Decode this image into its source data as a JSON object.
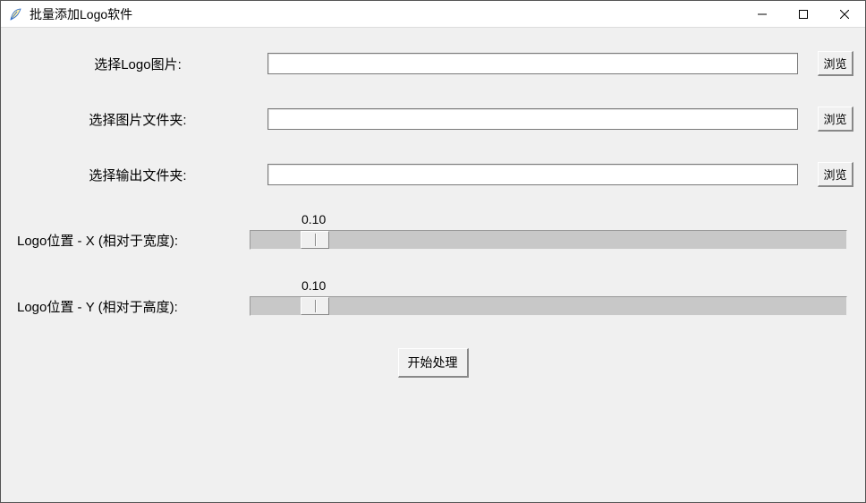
{
  "titlebar": {
    "title": "批量添加Logo软件"
  },
  "rows": {
    "logo_image": {
      "label": "选择Logo图片:",
      "value": "",
      "browse": "浏览"
    },
    "image_folder": {
      "label": "选择图片文件夹:",
      "value": "",
      "browse": "浏览"
    },
    "output_folder": {
      "label": "选择输出文件夹:",
      "value": "",
      "browse": "浏览"
    }
  },
  "sliders": {
    "x": {
      "label": "Logo位置 - X (相对于宽度):",
      "value": "0.10",
      "pos_percent": 10
    },
    "y": {
      "label": "Logo位置 - Y (相对于高度):",
      "value": "0.10",
      "pos_percent": 10
    }
  },
  "action": {
    "start": "开始处理"
  }
}
